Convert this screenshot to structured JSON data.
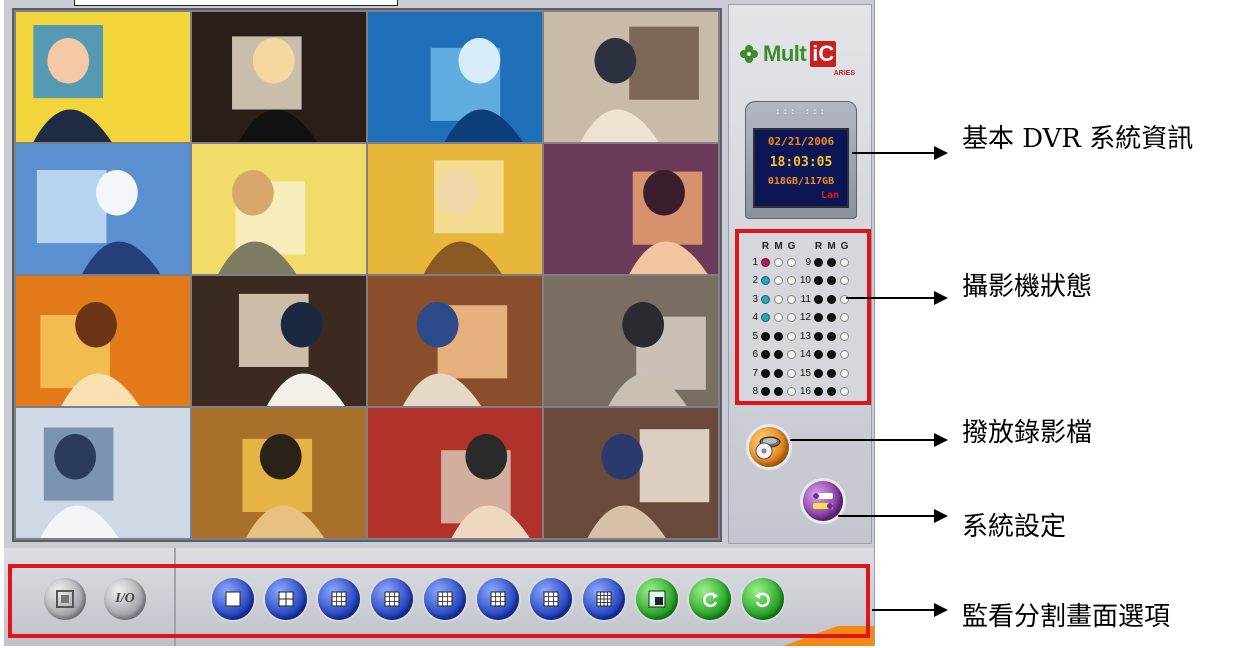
{
  "dvr_info": {
    "date": "02/21/2006",
    "time": "18:03:05",
    "disk": "018GB/117GB",
    "network": "Lan",
    "vents": "::: :::"
  },
  "brand": {
    "name": "Mult",
    "ic": "iC",
    "sub": "ARIES",
    "accent_green": "#3d8c2a",
    "accent_red": "#c8201c"
  },
  "camera_status": {
    "headers": [
      "R",
      "M",
      "G",
      "R",
      "M",
      "G"
    ],
    "rows": [
      {
        "left": {
          "num": "1",
          "leds": [
            "red",
            "off",
            "off"
          ]
        },
        "right": {
          "num": "9",
          "leds": [
            "dark",
            "dark",
            "off"
          ]
        }
      },
      {
        "left": {
          "num": "2",
          "leds": [
            "cyan",
            "off",
            "off"
          ]
        },
        "right": {
          "num": "10",
          "leds": [
            "dark",
            "dark",
            "off"
          ]
        }
      },
      {
        "left": {
          "num": "3",
          "leds": [
            "cyan",
            "off",
            "off"
          ]
        },
        "right": {
          "num": "11",
          "leds": [
            "dark",
            "dark",
            "off"
          ]
        }
      },
      {
        "left": {
          "num": "4",
          "leds": [
            "cyan",
            "off",
            "off"
          ]
        },
        "right": {
          "num": "12",
          "leds": [
            "dark",
            "dark",
            "off"
          ]
        }
      },
      {
        "left": {
          "num": "5",
          "leds": [
            "dark",
            "dark",
            "off"
          ]
        },
        "right": {
          "num": "13",
          "leds": [
            "dark",
            "dark",
            "off"
          ]
        }
      },
      {
        "left": {
          "num": "6",
          "leds": [
            "dark",
            "dark",
            "off"
          ]
        },
        "right": {
          "num": "14",
          "leds": [
            "dark",
            "dark",
            "off"
          ]
        }
      },
      {
        "left": {
          "num": "7",
          "leds": [
            "dark",
            "dark",
            "off"
          ]
        },
        "right": {
          "num": "15",
          "leds": [
            "dark",
            "dark",
            "off"
          ]
        }
      },
      {
        "left": {
          "num": "8",
          "leds": [
            "dark",
            "dark",
            "off"
          ]
        },
        "right": {
          "num": "16",
          "leds": [
            "dark",
            "dark",
            "off"
          ]
        }
      }
    ]
  },
  "side_buttons": {
    "playback_icon": "film-reel-disc-icon",
    "settings_icon": "wrench-tools-icon"
  },
  "toolbar": {
    "buttons": [
      {
        "name": "fullscreen-button",
        "icon": "fullscreen-icon",
        "style": "gray"
      },
      {
        "name": "io-button",
        "label": "I/O",
        "style": "gray"
      },
      {
        "name": "layout-1-button",
        "icon": "single-view-icon",
        "style": "blue"
      },
      {
        "name": "layout-4-button",
        "icon": "quad-view-icon",
        "style": "blue"
      },
      {
        "name": "layout-6-button",
        "icon": "split-6-icon",
        "style": "blue"
      },
      {
        "name": "layout-8-button",
        "icon": "split-8-icon",
        "style": "blue"
      },
      {
        "name": "layout-9-button",
        "icon": "split-9-icon",
        "style": "blue"
      },
      {
        "name": "layout-10-button",
        "icon": "split-10-icon",
        "style": "blue"
      },
      {
        "name": "layout-13-button",
        "icon": "split-13-icon",
        "style": "blue"
      },
      {
        "name": "layout-16-button",
        "icon": "split-16-icon",
        "style": "blue"
      },
      {
        "name": "pip-button",
        "icon": "picture-in-picture-icon",
        "style": "green"
      },
      {
        "name": "sequence-button",
        "icon": "rotate-right-icon",
        "style": "green"
      },
      {
        "name": "reverse-sequence-button",
        "icon": "rotate-left-icon",
        "style": "green"
      }
    ]
  },
  "callouts": {
    "dvr_info": "基本 DVR 系統資訊",
    "camera_status": "攝影機狀態",
    "playback": "撥放錄影檔",
    "settings": "系統設定",
    "split_options": "監看分割畫面選項"
  }
}
